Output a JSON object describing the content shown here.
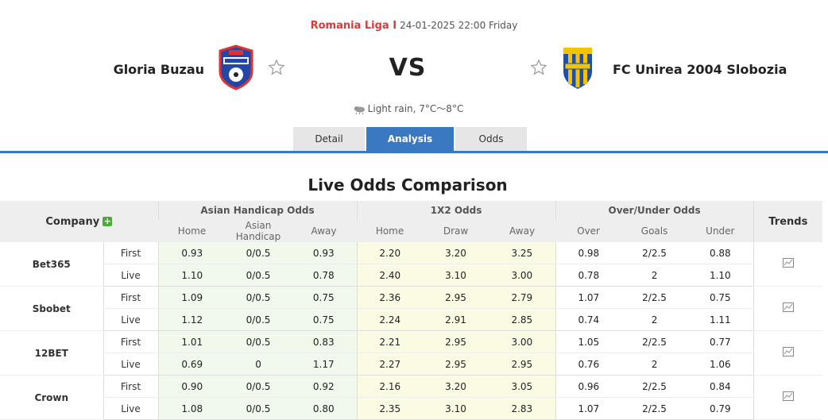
{
  "match": {
    "league": "Romania Liga I",
    "datetime": "24-01-2025 22:00 Friday",
    "home_team": "Gloria Buzau",
    "away_team": "FC Unirea 2004 Slobozia",
    "vs": "VS",
    "weather": "Light rain, 7°C～8°C"
  },
  "tabs": [
    {
      "label": "Detail"
    },
    {
      "label": "Analysis",
      "active": true
    },
    {
      "label": "Odds"
    }
  ],
  "colors": {
    "accent": "#3a78c2",
    "league": "#d93a3a",
    "asian_bg": "#f0f9ec",
    "x12_bg": "#fbfbe3"
  },
  "section_title": "Live Odds Comparison",
  "table": {
    "company_header": "Company",
    "groups": [
      "Asian Handicap Odds",
      "1X2 Odds",
      "Over/Under Odds"
    ],
    "trends_header": "Trends",
    "subheaders": [
      "Home",
      "Asian Handicap",
      "Away",
      "Home",
      "Draw",
      "Away",
      "Over",
      "Goals",
      "Under"
    ],
    "bookmakers": [
      {
        "name": "Bet365",
        "rows": [
          {
            "type": "First",
            "values": [
              "0.93",
              "0/0.5",
              "0.93",
              "2.20",
              "3.20",
              "3.25",
              "0.98",
              "2/2.5",
              "0.88"
            ]
          },
          {
            "type": "Live",
            "values": [
              "1.10",
              "0/0.5",
              "0.78",
              "2.40",
              "3.10",
              "3.00",
              "0.78",
              "2",
              "1.10"
            ]
          }
        ]
      },
      {
        "name": "Sbobet",
        "rows": [
          {
            "type": "First",
            "values": [
              "1.09",
              "0/0.5",
              "0.75",
              "2.36",
              "2.95",
              "2.79",
              "1.07",
              "2/2.5",
              "0.75"
            ]
          },
          {
            "type": "Live",
            "values": [
              "1.12",
              "0/0.5",
              "0.75",
              "2.24",
              "2.91",
              "2.85",
              "0.74",
              "2",
              "1.11"
            ]
          }
        ]
      },
      {
        "name": "12BET",
        "rows": [
          {
            "type": "First",
            "values": [
              "1.01",
              "0/0.5",
              "0.83",
              "2.21",
              "2.95",
              "3.00",
              "1.05",
              "2/2.5",
              "0.77"
            ]
          },
          {
            "type": "Live",
            "values": [
              "0.69",
              "0",
              "1.17",
              "2.27",
              "2.95",
              "2.95",
              "0.76",
              "2",
              "1.06"
            ]
          }
        ]
      },
      {
        "name": "Crown",
        "rows": [
          {
            "type": "First",
            "values": [
              "0.90",
              "0/0.5",
              "0.92",
              "2.16",
              "3.20",
              "3.05",
              "0.96",
              "2/2.5",
              "0.84"
            ]
          },
          {
            "type": "Live",
            "values": [
              "1.08",
              "0/0.5",
              "0.80",
              "2.35",
              "3.10",
              "2.83",
              "1.07",
              "2/2.5",
              "0.79"
            ]
          }
        ]
      }
    ]
  }
}
